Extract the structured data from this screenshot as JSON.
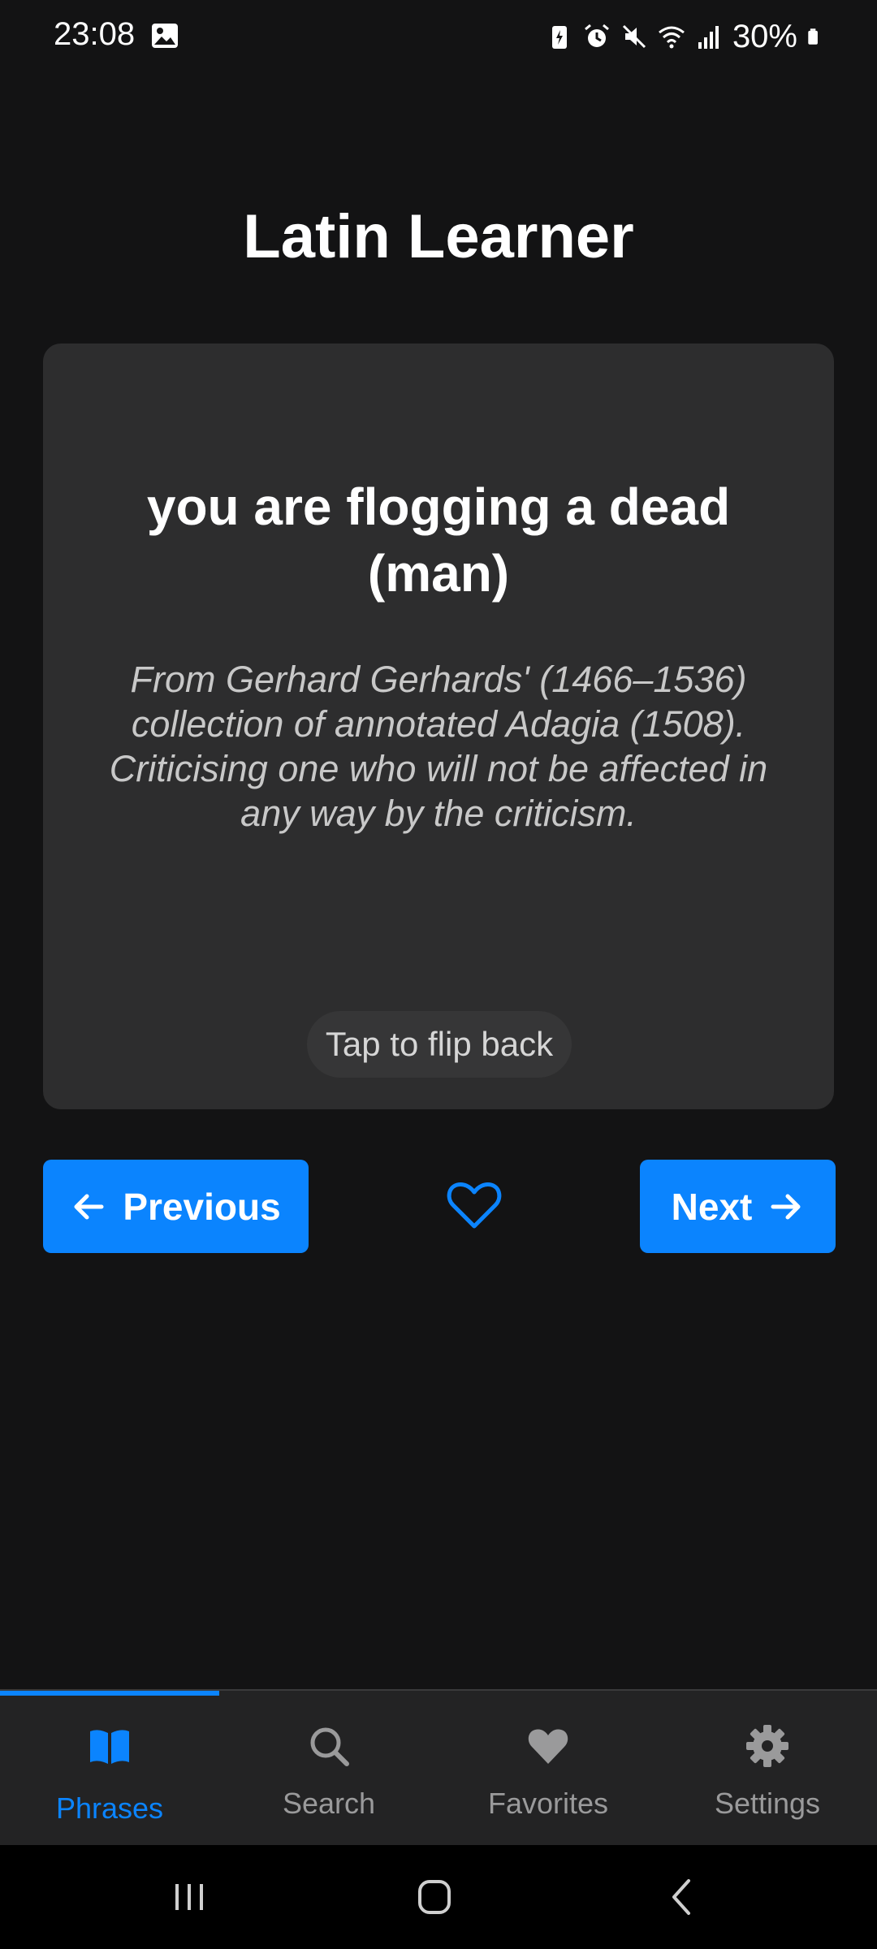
{
  "status_bar": {
    "time": "23:08",
    "battery": "30%",
    "icons": [
      "image-icon",
      "battery-saver-icon",
      "alarm-icon",
      "mute-icon",
      "wifi-icon",
      "signal-icon",
      "battery-icon"
    ]
  },
  "header": {
    "title": "Latin Learner"
  },
  "card": {
    "phrase": "you are flogging a dead (man)",
    "description": "From Gerhard Gerhards' (1466–1536) collection of annotated Adagia (1508). Criticising one who will not be affected in any way by the criticism.",
    "flip_hint": "Tap to flip back"
  },
  "controls": {
    "previous_label": "Previous",
    "next_label": "Next",
    "favorite_icon": "heart-outline-icon"
  },
  "tabs": [
    {
      "label": "Phrases",
      "icon": "book-icon",
      "active": true
    },
    {
      "label": "Search",
      "icon": "search-icon",
      "active": false
    },
    {
      "label": "Favorites",
      "icon": "heart-icon",
      "active": false
    },
    {
      "label": "Settings",
      "icon": "gear-icon",
      "active": false
    }
  ],
  "colors": {
    "accent": "#0b84fe",
    "background": "#131314",
    "card": "#2d2d2e"
  }
}
